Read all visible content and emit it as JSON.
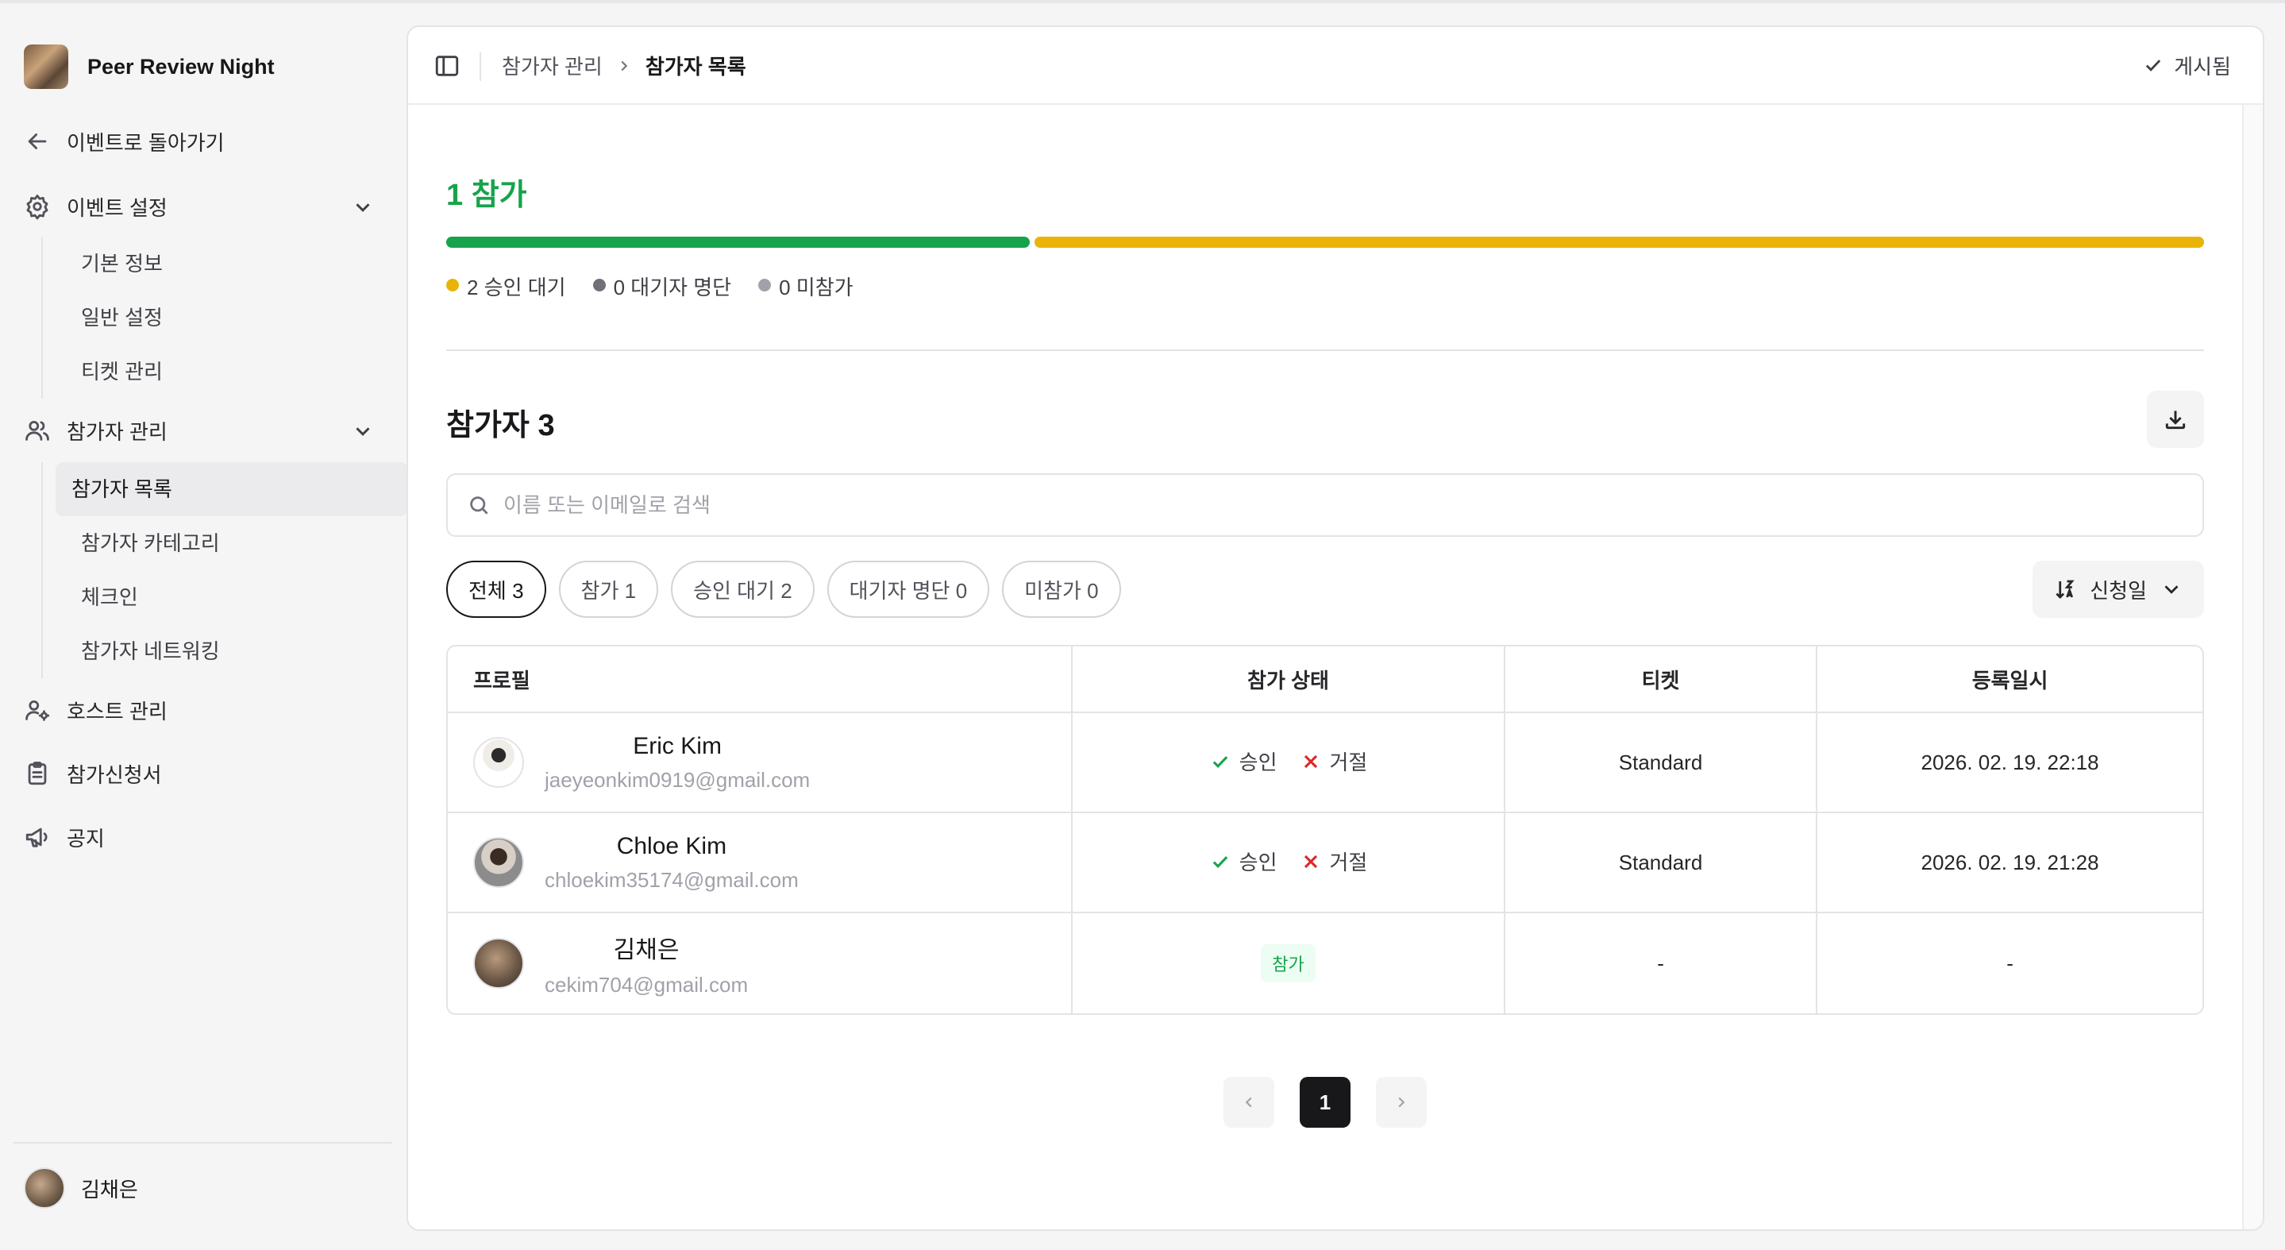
{
  "sidebar": {
    "brand_name": "Peer Review Night",
    "back_label": "이벤트로 돌아가기",
    "event_settings": {
      "label": "이벤트 설정",
      "items": [
        "기본 정보",
        "일반 설정",
        "티켓 관리"
      ]
    },
    "participants": {
      "label": "참가자 관리",
      "items": [
        "참가자 목록",
        "참가자 카테고리",
        "체크인",
        "참가자 네트워킹"
      ]
    },
    "host_label": "호스트 관리",
    "application_label": "참가신청서",
    "notice_label": "공지",
    "user_name": "김채은"
  },
  "topbar": {
    "crumb_parent": "참가자 관리",
    "crumb_current": "참가자 목록",
    "published_label": "게시됨"
  },
  "summary": {
    "title": "1 참가",
    "approved_fraction": 0.333,
    "legend": [
      {
        "label": "2 승인 대기",
        "color": "#eab308"
      },
      {
        "label": "0 대기자 명단",
        "color": "#71717a"
      },
      {
        "label": "0 미참가",
        "color": "#a1a1aa"
      }
    ]
  },
  "list": {
    "title": "참가자 3",
    "search_placeholder": "이름 또는 이메일로 검색",
    "filters": [
      "전체 3",
      "참가 1",
      "승인 대기 2",
      "대기자 명단 0",
      "미참가 0"
    ],
    "sort_label": "신청일",
    "columns": [
      "프로필",
      "참가 상태",
      "티켓",
      "등록일시"
    ],
    "approve_label": "승인",
    "reject_label": "거절",
    "rows": [
      {
        "name": "Eric Kim",
        "email": "jaeyeonkim0919@gmail.com",
        "status": "pending",
        "ticket": "Standard",
        "date": "2026. 02. 19. 22:18"
      },
      {
        "name": "Chloe Kim",
        "email": "chloekim35174@gmail.com",
        "status": "pending",
        "ticket": "Standard",
        "date": "2026. 02. 19. 21:28"
      },
      {
        "name": "김채은",
        "email": "cekim704@gmail.com",
        "status": "참가",
        "ticket": "-",
        "date": "-"
      }
    ]
  },
  "pagination": {
    "current_page": "1"
  },
  "colors": {
    "accent_green": "#16a34a",
    "pending_yellow": "#eab308",
    "reject_red": "#dc2626"
  }
}
